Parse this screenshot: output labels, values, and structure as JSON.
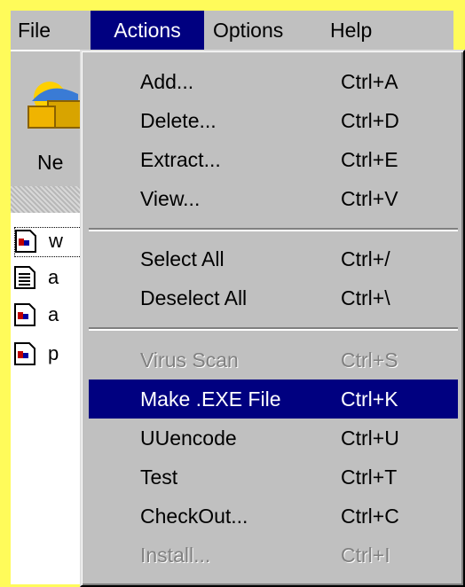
{
  "menubar": {
    "file": "File",
    "actions": "Actions",
    "options": "Options",
    "help": "Help"
  },
  "toolbar": {
    "new_label": "Ne"
  },
  "files": [
    {
      "name": "w",
      "icon": "winzip-file-icon"
    },
    {
      "name": "a",
      "icon": "text-document-icon"
    },
    {
      "name": "a",
      "icon": "winzip-file-icon"
    },
    {
      "name": "p",
      "icon": "winzip-file-icon"
    }
  ],
  "menu": {
    "items": [
      {
        "label": "Add...",
        "shortcut": "Ctrl+A",
        "state": "enabled"
      },
      {
        "label": "Delete...",
        "shortcut": "Ctrl+D",
        "state": "enabled"
      },
      {
        "label": "Extract...",
        "shortcut": "Ctrl+E",
        "state": "enabled"
      },
      {
        "label": "View...",
        "shortcut": "Ctrl+V",
        "state": "enabled"
      },
      {
        "label": "Select All",
        "shortcut": "Ctrl+/",
        "state": "enabled"
      },
      {
        "label": "Deselect All",
        "shortcut": "Ctrl+\\",
        "state": "enabled"
      },
      {
        "label": "Virus Scan",
        "shortcut": "Ctrl+S",
        "state": "disabled"
      },
      {
        "label": "Make .EXE File",
        "shortcut": "Ctrl+K",
        "state": "highlighted"
      },
      {
        "label": "UUencode",
        "shortcut": "Ctrl+U",
        "state": "enabled"
      },
      {
        "label": "Test",
        "shortcut": "Ctrl+T",
        "state": "enabled"
      },
      {
        "label": "CheckOut...",
        "shortcut": "Ctrl+C",
        "state": "enabled"
      },
      {
        "label": "Install...",
        "shortcut": "Ctrl+I",
        "state": "disabled"
      }
    ]
  },
  "colors": {
    "background": "#fffb5a",
    "menu_face": "#c0c0c0",
    "highlight": "#000080",
    "disabled_text": "#808080"
  }
}
